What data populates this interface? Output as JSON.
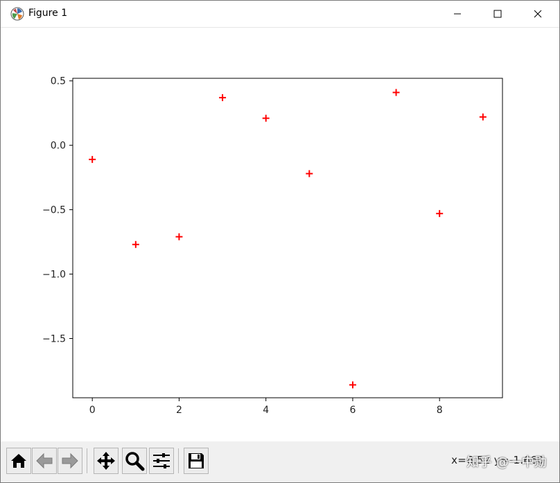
{
  "window": {
    "title": "Figure 1",
    "icon": "matplotlib-logo-icon"
  },
  "titlebar_buttons": [
    "minimize-icon",
    "maximize-icon",
    "close-icon"
  ],
  "toolbar": {
    "buttons": [
      "home-icon",
      "back-arrow-icon",
      "forward-arrow-icon",
      "pan-move-icon",
      "zoom-magnifier-icon",
      "configure-subplots-icon",
      "save-floppy-icon"
    ],
    "coordinates_text": "x=6.52 y=-1.660",
    "watermark": "知乎 @一中勋"
  },
  "chart_data": {
    "type": "scatter",
    "marker": "+",
    "color": "#ff0000",
    "x": [
      0,
      1,
      2,
      3,
      4,
      5,
      6,
      7,
      8,
      9
    ],
    "y": [
      -0.11,
      -0.77,
      -0.71,
      0.37,
      0.21,
      -0.22,
      -1.86,
      0.41,
      -0.53,
      0.22
    ],
    "xlim": [
      -0.45,
      9.45
    ],
    "ylim": [
      -1.96,
      0.52
    ],
    "xticks": [
      0,
      2,
      4,
      6,
      8
    ],
    "xtick_labels": [
      "0",
      "2",
      "4",
      "6",
      "8"
    ],
    "yticks": [
      0.5,
      0.0,
      -0.5,
      -1.0,
      -1.5
    ],
    "ytick_labels": [
      "0.5",
      "0.0",
      "−0.5",
      "−1.0",
      "−1.5"
    ],
    "title": "",
    "xlabel": "",
    "ylabel": "",
    "grid": false
  }
}
